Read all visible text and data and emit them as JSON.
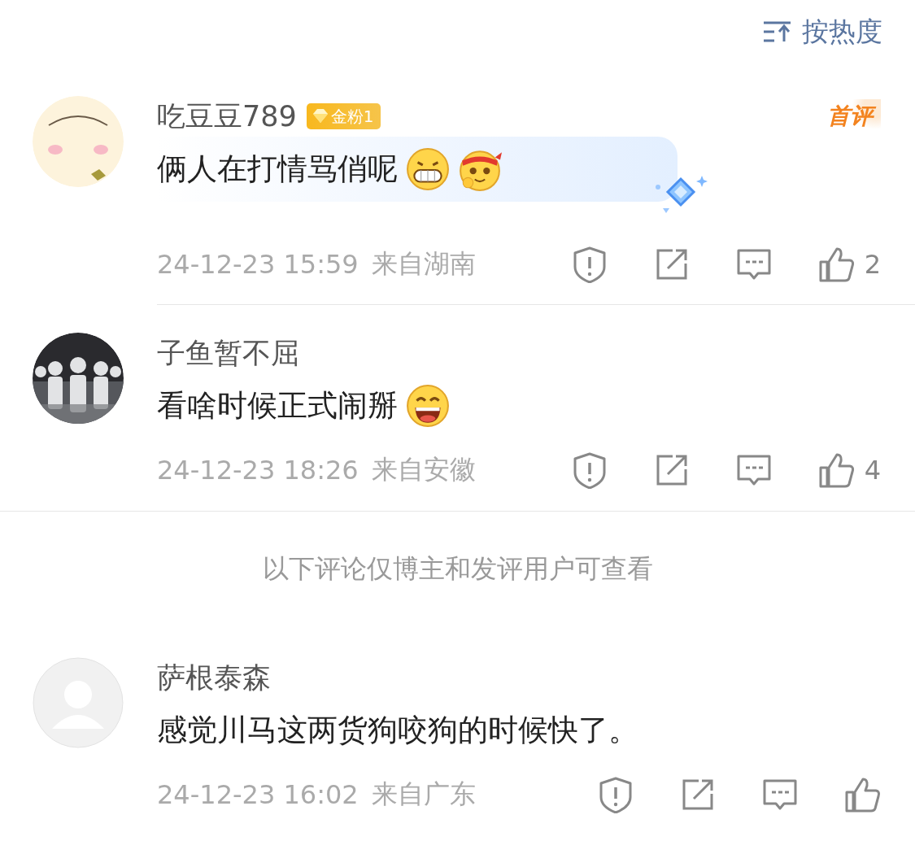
{
  "sort": {
    "label": "按热度"
  },
  "comments": [
    {
      "avatar": {
        "kind": "cartoon"
      },
      "name": "吃豆豆789",
      "badge": "金粉1",
      "tag": "首评",
      "content": "俩人在打情骂俏呢",
      "emojis": [
        {
          "kind": "grin"
        },
        {
          "kind": "headband"
        }
      ],
      "fan_card": true,
      "date": "24-12-23 15:59",
      "location": "来自湖南",
      "likes": "2",
      "divider": {
        "kind": "inset"
      }
    },
    {
      "avatar": {
        "kind": "picture"
      },
      "name": "子鱼暂不屈",
      "content": "看啥时候正式闹掰",
      "emojis": [
        {
          "kind": "laugh"
        }
      ],
      "fan_card": false,
      "date": "24-12-23 18:26",
      "location": "来自安徽",
      "likes": "4",
      "divider": {
        "kind": "full"
      }
    }
  ],
  "notice": "以下评论仅博主和发评用户可查看",
  "private_comments": [
    {
      "avatar": {
        "kind": "default"
      },
      "name": "萨根泰森",
      "content": "感觉川马这两货狗咬狗的时候快了。",
      "fan_card": false,
      "date": "24-12-23 16:02",
      "location": "来自广东"
    }
  ]
}
